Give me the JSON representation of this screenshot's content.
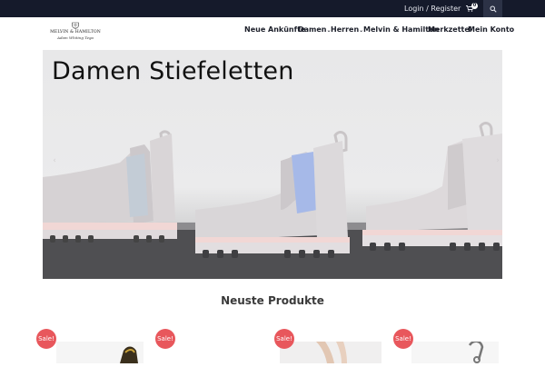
{
  "topbar": {
    "login_label": "Login / Register",
    "cart_count": "0",
    "cart_icon": "shopping-cart-icon",
    "search_icon": "search-icon"
  },
  "logo": {
    "name": "MELVIN & HAMILTON",
    "subtitle": "Adam Whiting Tega"
  },
  "nav": {
    "items": [
      {
        "label": "Neue Ankünfte"
      },
      {
        "label": "Damen"
      },
      {
        "label": "Herren"
      },
      {
        "label": "Melvin & Hamilton"
      },
      {
        "label": "Merkzettel"
      },
      {
        "label": "Mein Konto"
      }
    ]
  },
  "hero": {
    "title": "Damen Stiefeletten"
  },
  "section": {
    "title": "Neuste Produkte"
  },
  "products": [
    {
      "badge": "Sale!"
    },
    {
      "badge": "Sale!"
    },
    {
      "badge": "Sale!"
    },
    {
      "badge": "Sale!"
    }
  ],
  "colors": {
    "topbar": "#151a2b",
    "sale": "#e8575c",
    "boot_elastic": "#a6b9e8"
  }
}
